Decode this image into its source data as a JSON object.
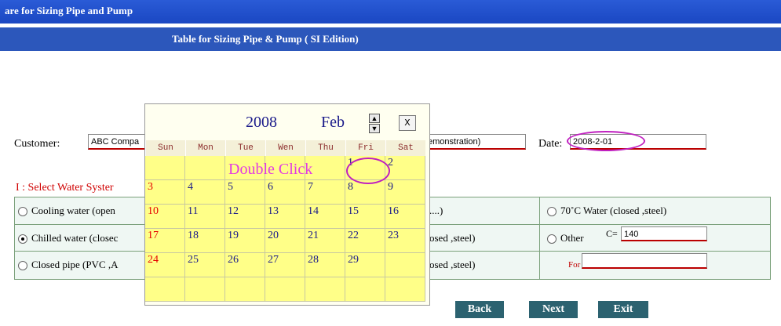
{
  "app": {
    "title": "are for Sizing Pipe and Pump",
    "subtitle": "Table for Sizing Pipe & Pump ( SI  Edition)"
  },
  "form": {
    "customer_label": "Customer:",
    "customer_value": "ABC Compa",
    "project_value_tail": "emonstration)",
    "date_label": "Date:",
    "date_value": "2008-2-01"
  },
  "water_system": {
    "section_title": "I : Select Water Syster",
    "rows": [
      {
        "left": "Cooling water (open",
        "middle": "....)",
        "right": "70˚C   Water (closed ,steel)",
        "left_selected": false,
        "right_selected": false
      },
      {
        "left": "Chilled water (closec",
        "middle": "osed ,steel)",
        "right": "Other",
        "left_selected": true,
        "right_selected": false
      },
      {
        "left": "Closed pipe (PVC ,A",
        "middle": "osed ,steel)",
        "right": "",
        "left_selected": false,
        "right_selected": false
      }
    ],
    "other_c_label": "C=",
    "other_c_value": "140",
    "for_label": "For"
  },
  "calendar": {
    "year": "2008",
    "month": "Feb",
    "close_label": "X",
    "days_of_week": [
      "Sun",
      "Mon",
      "Tue",
      "Wen",
      "Thu",
      "Fri",
      "Sat"
    ],
    "weeks": [
      [
        "",
        "",
        "",
        "",
        "",
        "1",
        "2"
      ],
      [
        "3",
        "4",
        "5",
        "6",
        "7",
        "8",
        "9"
      ],
      [
        "10",
        "11",
        "12",
        "13",
        "14",
        "15",
        "16"
      ],
      [
        "17",
        "18",
        "19",
        "20",
        "21",
        "22",
        "23"
      ],
      [
        "24",
        "25",
        "26",
        "27",
        "28",
        "29",
        ""
      ],
      [
        "",
        "",
        "",
        "",
        "",
        "",
        ""
      ]
    ],
    "annotation": "Double Click"
  },
  "buttons": {
    "back": "Back",
    "next": "Next",
    "exit": "Exit"
  },
  "colors": {
    "title_bar": "#1a47c2",
    "subtitle_bar": "#2c57bb",
    "calendar_cell": "#ffff88",
    "annotation": "#e33be3",
    "button": "#2c6270"
  }
}
